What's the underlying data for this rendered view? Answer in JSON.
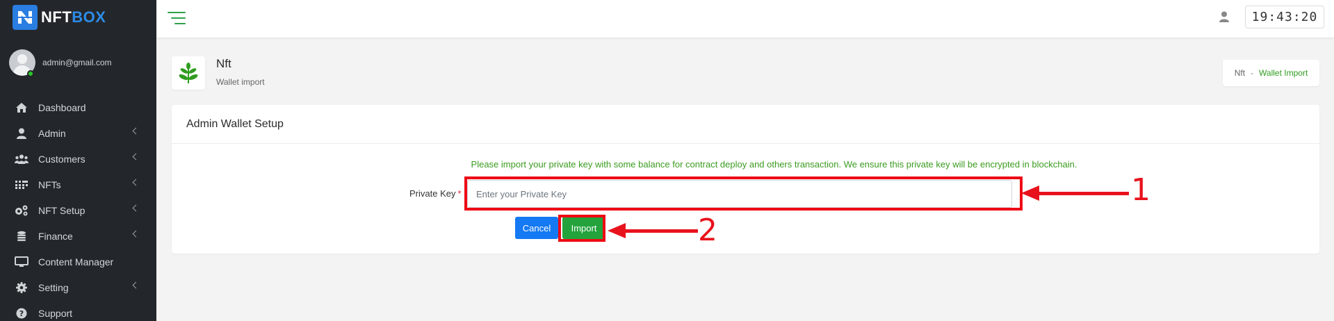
{
  "brand": {
    "name_part1": "NFT",
    "name_part2": "BOX"
  },
  "user": {
    "email": "admin@gmail.com"
  },
  "sidebar": {
    "items": [
      {
        "label": "Dashboard",
        "icon": "home-icon"
      },
      {
        "label": "Admin",
        "icon": "user-icon"
      },
      {
        "label": "Customers",
        "icon": "users-icon"
      },
      {
        "label": "NFTs",
        "icon": "grid-icon"
      },
      {
        "label": "NFT Setup",
        "icon": "gears-icon"
      },
      {
        "label": "Finance",
        "icon": "coins-icon"
      },
      {
        "label": "Content Manager",
        "icon": "monitor-icon"
      },
      {
        "label": "Setting",
        "icon": "gear-icon"
      },
      {
        "label": "Support",
        "icon": "question-icon"
      }
    ]
  },
  "header": {
    "clock": "19:43:20"
  },
  "page": {
    "title": "Nft",
    "subtitle": "Wallet import"
  },
  "breadcrumb": {
    "root": "Nft",
    "separator": "-",
    "current": "Wallet Import"
  },
  "card": {
    "title": "Admin Wallet Setup",
    "notice": "Please import your private key with some balance for contract deploy and others transaction. We ensure this private key will be encrypted in blockchain.",
    "private_key_label": "Private Key",
    "required_mark": "*",
    "private_key_placeholder": "Enter your Private Key",
    "cancel_label": "Cancel",
    "import_label": "Import"
  },
  "annotations": {
    "step1": "1",
    "step2": "2"
  },
  "colors": {
    "sidebar_bg": "#23272b",
    "accent_green": "#24a33d",
    "primary_blue": "#1479f3",
    "annotation_red": "#e8121c"
  }
}
